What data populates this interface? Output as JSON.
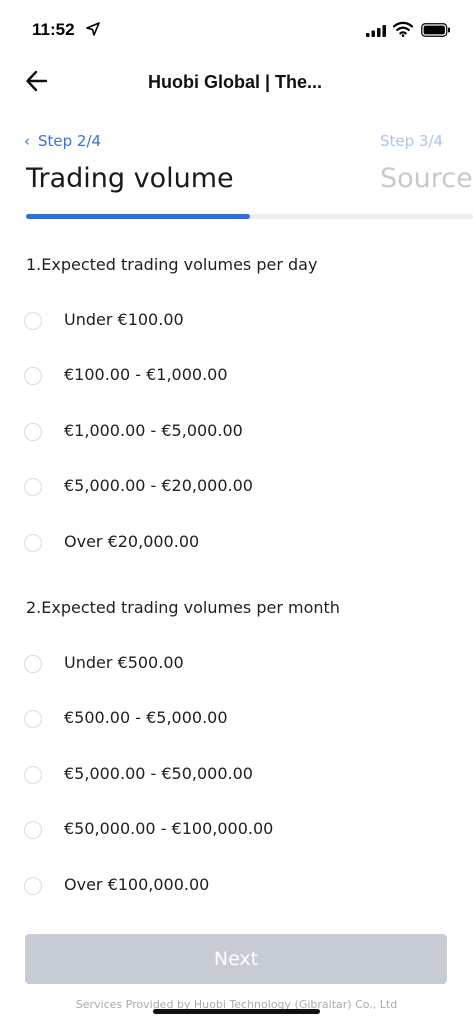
{
  "status": {
    "time": "11:52"
  },
  "nav": {
    "title": "Huobi Global | The...",
    "back_icon": "arrow-left-icon"
  },
  "steps": {
    "prev_label": "Step 2/4",
    "current_title": "Trading volume",
    "next_label": "Step 3/4",
    "next_title": "Source",
    "progress": 0.5
  },
  "questions": [
    {
      "text": "1.Expected trading volumes per day",
      "options": [
        "Under €100.00",
        "€100.00 - €1,000.00",
        "€1,000.00 - €5,000.00",
        "€5,000.00 - €20,000.00",
        "Over €20,000.00"
      ]
    },
    {
      "text": "2.Expected trading volumes per month",
      "options": [
        "Under €500.00",
        "€500.00 - €5,000.00",
        "€5,000.00 - €50,000.00",
        "€50,000.00 - €100,000.00",
        "Over €100,000.00"
      ]
    }
  ],
  "buttons": {
    "next": "Next"
  },
  "footer": "Services Provided by Huobi Technology (Gibraltar) Co., Ltd",
  "colors": {
    "accent": "#2e6fe0",
    "step_link": "#3b73d9",
    "disabled_button": "#c7cbd4"
  }
}
